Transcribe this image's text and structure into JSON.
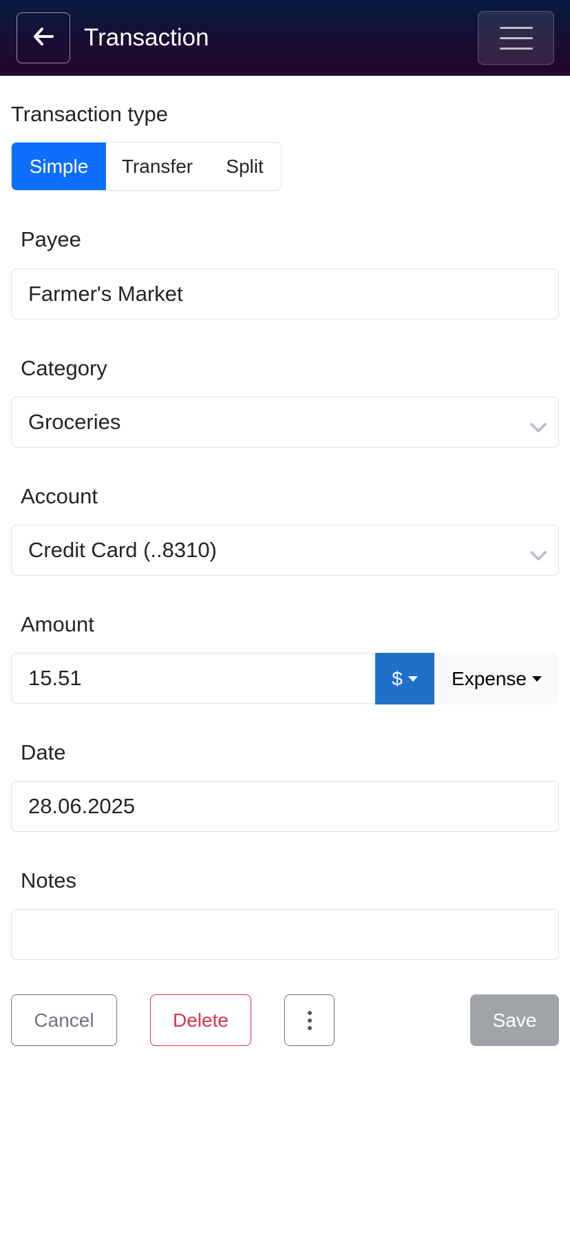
{
  "header": {
    "title": "Transaction",
    "back_icon": "arrow-left-icon",
    "menu_icon": "hamburger-menu-icon"
  },
  "transaction_type": {
    "label": "Transaction type",
    "options": [
      "Simple",
      "Transfer",
      "Split"
    ],
    "selected": "Simple"
  },
  "payee": {
    "label": "Payee",
    "value": "Farmer's Market"
  },
  "category": {
    "label": "Category",
    "value": "Groceries"
  },
  "account": {
    "label": "Account",
    "value": "Credit Card (..8310)"
  },
  "amount": {
    "label": "Amount",
    "value": "15.51",
    "currency": "$",
    "direction": "Expense"
  },
  "date": {
    "label": "Date",
    "value": "28.06.2025"
  },
  "notes": {
    "label": "Notes",
    "value": ""
  },
  "actions": {
    "cancel": "Cancel",
    "delete": "Delete",
    "save": "Save"
  },
  "colors": {
    "primary": "#0d6efd",
    "currency_button": "#1f70c9",
    "danger": "#dc3545",
    "secondary": "#6c757d",
    "save_disabled": "#9fa4a9",
    "header_top": "#061a3f",
    "header_bottom": "#23062b"
  }
}
